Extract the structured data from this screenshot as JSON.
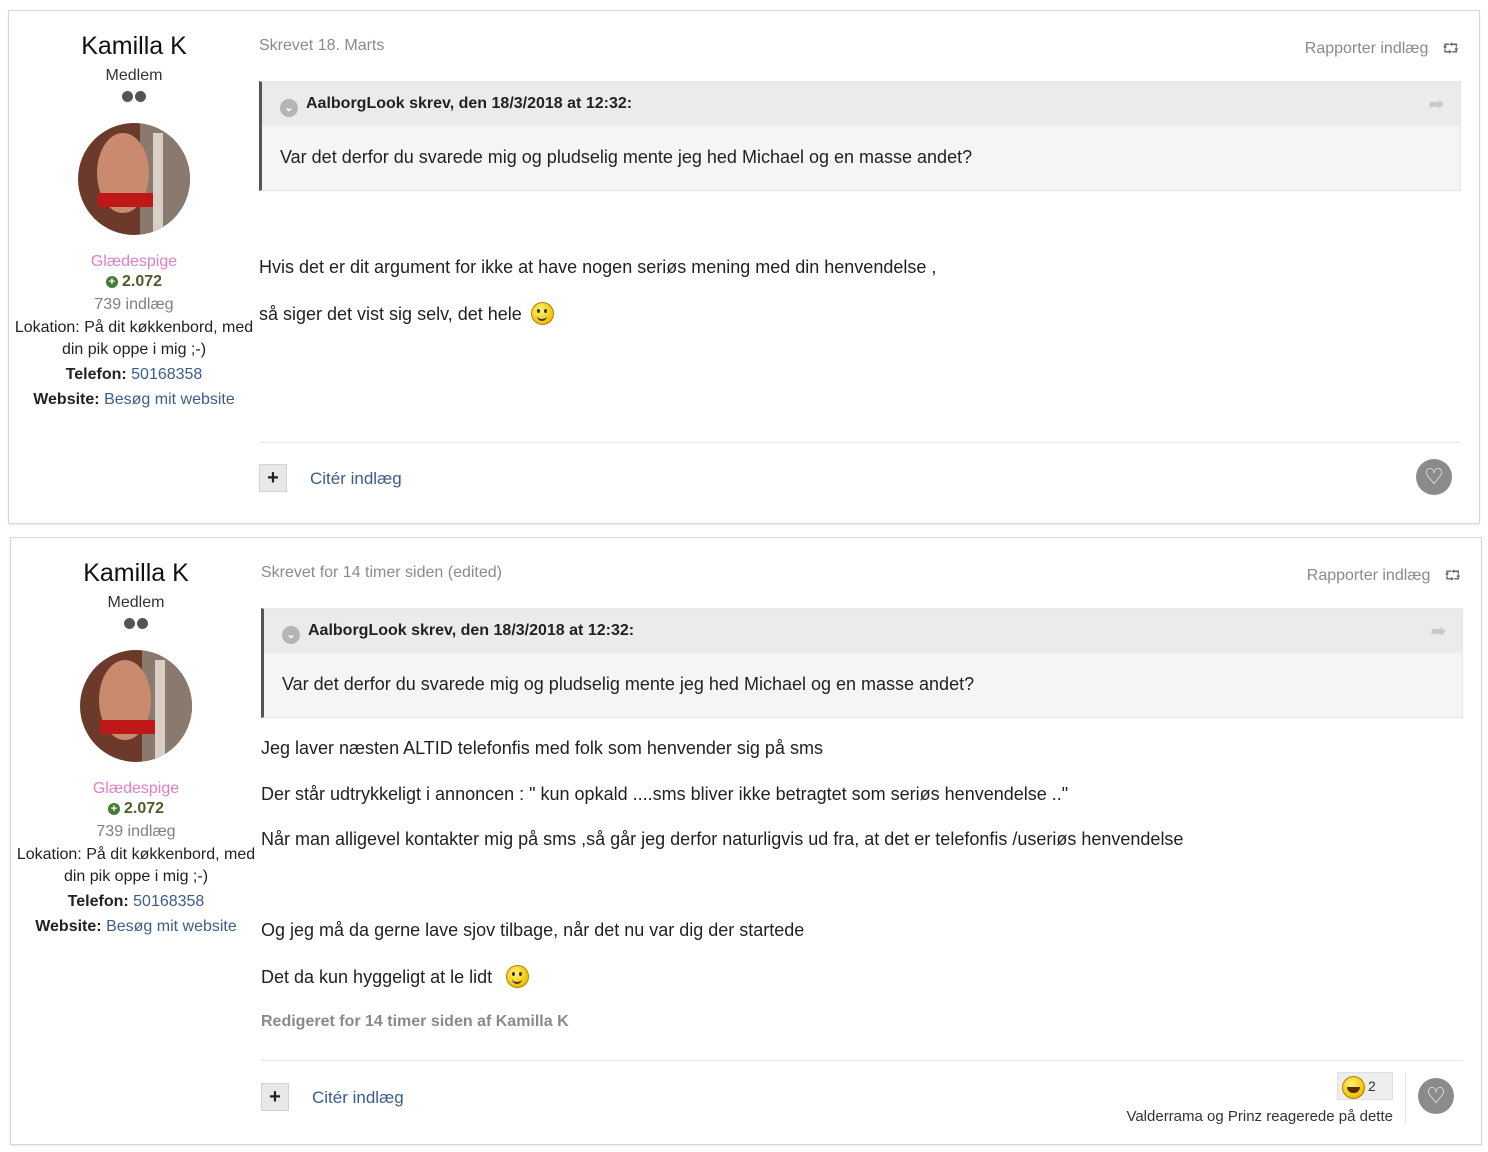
{
  "posts": [
    {
      "author": {
        "name": "Kamilla K",
        "title": "Medlem",
        "group": "Glædespige",
        "reputation": "2.072",
        "post_count": "739 indlæg",
        "location_label": "Lokation:",
        "location_value": "På dit køkkenbord, med din pik oppe i mig ;-)",
        "phone_label": "Telefon:",
        "phone_value": "50168358",
        "website_label": "Website:",
        "website_value": "Besøg mit website"
      },
      "meta": "Skrevet 18. Marts",
      "report": "Rapporter indlæg",
      "quote": {
        "header": "AalborgLook skrev, den 18/3/2018 at 12:32:",
        "body": "Var det derfor du svarede mig og pludselig mente jeg hed Michael og en masse andet?"
      },
      "paragraphs": [
        "Hvis det er dit argument for ikke at have nogen seriøs mening med din henvendelse ,",
        "så siger det vist sig selv, det hele"
      ],
      "cite": "Citér indlæg"
    },
    {
      "author": {
        "name": "Kamilla K",
        "title": "Medlem",
        "group": "Glædespige",
        "reputation": "2.072",
        "post_count": "739 indlæg",
        "location_label": "Lokation:",
        "location_value": "På dit køkkenbord, med din pik oppe i mig ;-)",
        "phone_label": "Telefon:",
        "phone_value": "50168358",
        "website_label": "Website:",
        "website_value": "Besøg mit website"
      },
      "meta": "Skrevet for 14 timer siden (edited)",
      "report": "Rapporter indlæg",
      "quote": {
        "header": "AalborgLook skrev, den 18/3/2018 at 12:32:",
        "body": "Var det derfor du svarede mig og pludselig mente jeg hed Michael og en masse andet?"
      },
      "paragraphs": [
        "Jeg laver næsten ALTID telefonfis med folk som henvender sig på sms",
        "Der står udtrykkeligt i annoncen : \" kun opkald ....sms bliver ikke betragtet som seriøs henvendelse ..\"",
        "Når man alligevel kontakter mig på sms ,så går jeg derfor naturligvis  ud fra,  at det er telefonfis /useriøs henvendelse",
        "Og jeg må da gerne lave sjov tilbage, når det nu var dig der startede",
        "Det da kun hyggeligt at le lidt"
      ],
      "edited_note": "Redigeret for 14 timer siden af Kamilla K",
      "cite": "Citér indlæg",
      "reactions": {
        "count": "2",
        "text": "Valderrama og Prinz reagerede på dette"
      }
    }
  ]
}
